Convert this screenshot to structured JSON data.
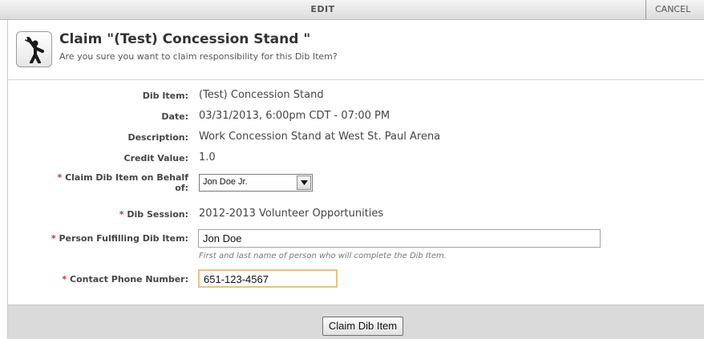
{
  "topbar": {
    "edit_label": "EDIT",
    "cancel_label": "CANCEL"
  },
  "header": {
    "icon": "person-waving-icon",
    "title": "Claim \"(Test) Concession Stand \"",
    "subtitle": "Are you sure you want to claim responsibility for this Dib Item?"
  },
  "fields": {
    "dib_item": {
      "label": "Dib Item:",
      "value": "(Test) Concession Stand"
    },
    "date": {
      "label": "Date:",
      "value": "03/31/2013, 6:00pm CDT - 07:00 PM"
    },
    "description": {
      "label": "Description:",
      "value": "Work Concession Stand at West St. Paul Arena"
    },
    "credit_value": {
      "label": "Credit Value:",
      "value": "1.0"
    },
    "claim_on_behalf": {
      "required_mark": "*",
      "label_line1": "Claim Dib Item on Behalf",
      "label_line2": "of:",
      "selected": "Jon Doe Jr."
    },
    "dib_session": {
      "required_mark": "*",
      "label": "Dib Session:",
      "value": "2012-2013 Volunteer Opportunities"
    },
    "person_fulfilling": {
      "required_mark": "*",
      "label": "Person Fulfilling Dib Item:",
      "value": "Jon Doe",
      "hint": "First and last name of person who will complete the Dib Item."
    },
    "contact_phone": {
      "required_mark": "*",
      "label": "Contact Phone Number:",
      "value": "651-123-4567"
    }
  },
  "footer": {
    "submit_label": "Claim Dib Item"
  },
  "colors": {
    "required": "#d9261c",
    "focus_border": "#e8c386",
    "footer_bg": "#dadada"
  }
}
